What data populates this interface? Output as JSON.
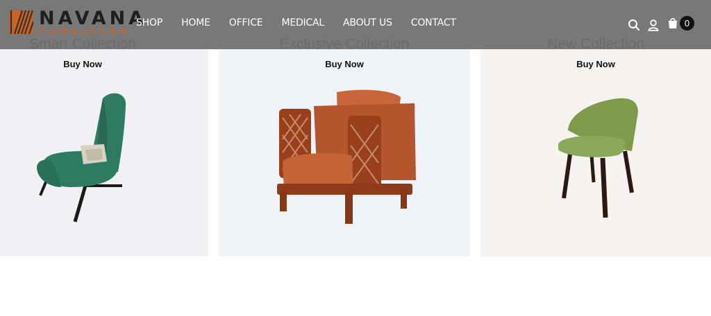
{
  "brand": {
    "name": "NAVANA",
    "tagline": "FURNITURE",
    "accent_color": "#d0621f"
  },
  "nav": {
    "items": [
      "SHOP",
      "HOME",
      "OFFICE",
      "MEDICAL",
      "ABOUT US",
      "CONTACT"
    ]
  },
  "header_icons": {
    "search": "search-icon",
    "account": "user-icon",
    "cart": "shopping-bag-icon",
    "cart_count": "0"
  },
  "collections": [
    {
      "title": "Smart Collection",
      "cta": "Buy Now",
      "product": "green-wingback-chair"
    },
    {
      "title": "Exclusive Collection",
      "cta": "Buy Now",
      "product": "orange-wooden-lattice-armchair"
    },
    {
      "title": "New Collection",
      "cta": "Buy Now",
      "product": "olive-green-dining-chair"
    }
  ]
}
